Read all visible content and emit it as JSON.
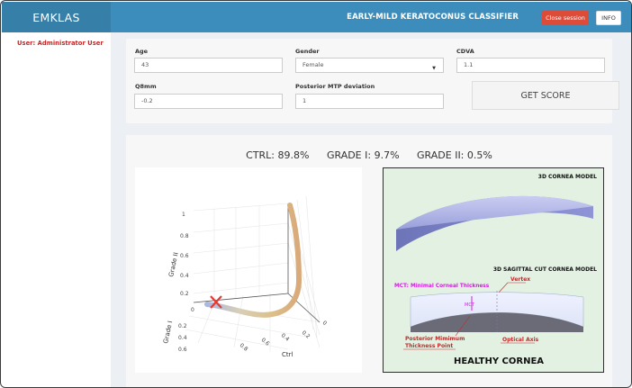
{
  "header": {
    "brand": "EMKLAS",
    "title": "EARLY-MILD KERATOCONUS CLASSIFIER",
    "close_label": "Close session",
    "info_label": "INFO"
  },
  "sidebar": {
    "user_label": "User: Administrator User"
  },
  "form": {
    "age": {
      "label": "Age",
      "value": "43"
    },
    "gender": {
      "label": "Gender",
      "value": "Female"
    },
    "cdva": {
      "label": "CDVA",
      "value": "1.1"
    },
    "q8mm": {
      "label": "Q8mm",
      "value": "-0.2"
    },
    "mtp": {
      "label": "Posterior MTP deviation",
      "value": "1"
    },
    "score_button": "GET SCORE"
  },
  "results": {
    "ctrl": "CTRL: 89.8%",
    "grade1": "GRADE I: 9.7%",
    "grade2": "GRADE II: 0.5%"
  },
  "plot3d": {
    "z_axis_label": "Grade II",
    "y_axis_label": "Grade I",
    "x_axis_label": "Ctrl",
    "z_ticks": [
      "1",
      "0.8",
      "0.6",
      "0.4",
      "0.2",
      "0"
    ],
    "y_ticks": [
      "0.2",
      "0.4",
      "0.6"
    ],
    "x_ticks": [
      "0.2",
      "0.4",
      "0.6",
      "0.8"
    ],
    "right_tick": "0",
    "marker_color": "#e53935"
  },
  "cornea": {
    "model_3d_title": "3D CORNEA MODEL",
    "sagittal_title": "3D SAGITTAL CUT CORNEA MODEL",
    "mct_label": "MCT: Minimal Corneal Thickness",
    "mct_short": "MCT",
    "vertex_label": "Vertex",
    "posterior_label_1": "Posterior Mimimum",
    "posterior_label_2": "Thickness Point",
    "optical_axis_label": "Optical Axis",
    "healthy_label": "HEALTHY CORNEA"
  }
}
